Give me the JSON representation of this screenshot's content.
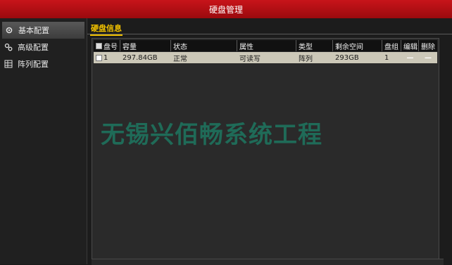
{
  "window": {
    "title": "硬盘管理"
  },
  "sidebar": {
    "items": [
      {
        "label": "基本配置",
        "icon": "gear-icon",
        "active": true
      },
      {
        "label": "高级配置",
        "icon": "gears-icon",
        "active": false
      },
      {
        "label": "阵列配置",
        "icon": "grid-icon",
        "active": false
      }
    ]
  },
  "tabs": [
    {
      "label": "硬盘信息",
      "active": true
    }
  ],
  "table": {
    "headers": [
      "盘号",
      "容量",
      "状态",
      "属性",
      "类型",
      "剩余空间",
      "盘组",
      "编辑",
      "删除"
    ],
    "rows": [
      {
        "id": "1",
        "capacity": "297.84GB",
        "status": "正常",
        "property": "可读写",
        "type": "阵列",
        "free": "293GB",
        "group": "1",
        "edit": "—",
        "delete": "—"
      }
    ]
  },
  "watermark": "无锡兴佰畅系统工程"
}
